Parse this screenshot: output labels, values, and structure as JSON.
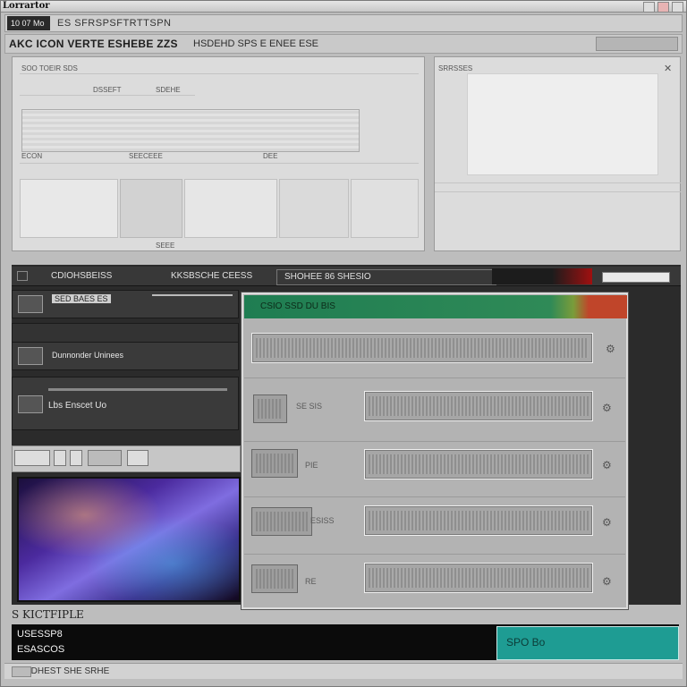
{
  "title": "Lorrartor",
  "tab": {
    "active": "10 07 Mo",
    "label": "ES SFRSPSFTRTTSPN"
  },
  "toolbar": {
    "project": "AKC ICON VERTE ESHEBE ZZS",
    "status": "HSDEHD SPS E ENEE ESE"
  },
  "panel_a": {
    "header": "SOO TOEIR SDS",
    "row_labels": [
      "DSSEFT",
      "SDEHE"
    ],
    "axis": [
      "ECON",
      "SEECEEE",
      "DEE"
    ],
    "caption": "SEEE"
  },
  "panel_b": {
    "header": "SRRSSES"
  },
  "dark_header": {
    "left": "CDIOHSBEISS",
    "mid": "KKSBSCHE CEESS",
    "control": "SHOHEE 86 SHESIO"
  },
  "rows": [
    {
      "label": "SED BAES ES"
    },
    {
      "label": "Dunnonder Uninees"
    },
    {
      "label": "Lbs Enscet Uo"
    }
  ],
  "dialog": {
    "title": "CSIO SSD DU BIS",
    "rows": [
      {
        "label": ""
      },
      {
        "label": "SE SIS"
      },
      {
        "label": "PIE"
      },
      {
        "label": "ESISS"
      },
      {
        "label": "RE"
      }
    ],
    "glyph": "⚙"
  },
  "selection_label": "S KICTFIPLE",
  "footer": {
    "line1": "USESSP8",
    "line2": "ESASCOS"
  },
  "ok_button": "SPO Bo",
  "status": "CCNDHEST SHE SRHE",
  "colors": {
    "accent": "#1e9c93",
    "title_green": "#2f8a57",
    "title_red": "#c0452a"
  }
}
